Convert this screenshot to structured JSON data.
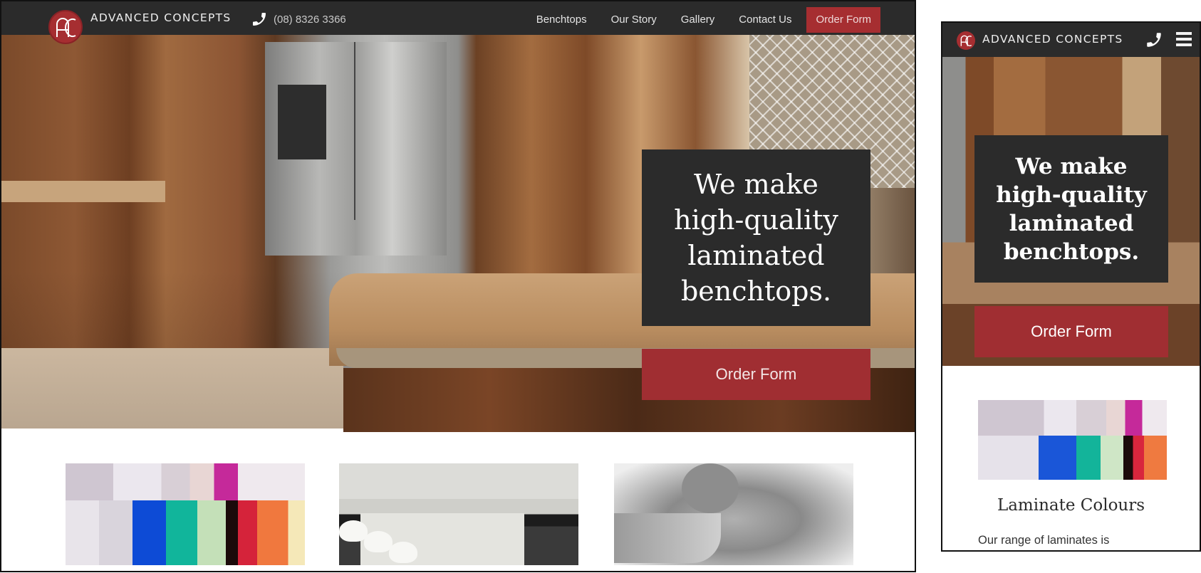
{
  "colors": {
    "nav_bg": "#2b2b2b",
    "accent": "#a02e32",
    "text_light": "#e4e4e4"
  },
  "brand": {
    "name": "ADVANCED CONCEPTS",
    "logo_icon": "ac-monogram-logo"
  },
  "header": {
    "phone_icon": "phone-icon",
    "phone": "(08) 8326 3366",
    "nav": [
      {
        "label": "Benchtops"
      },
      {
        "label": "Our Story"
      },
      {
        "label": "Gallery"
      },
      {
        "label": "Contact Us"
      }
    ],
    "cta": "Order Form"
  },
  "hero": {
    "headline": "We make high-quality laminated benchtops.",
    "button": "Order Form"
  },
  "cards": [
    {
      "image": "laminate-colour-samples"
    },
    {
      "image": "kitchen-island"
    },
    {
      "image": "benchtop-edge-profile"
    }
  ],
  "mobile": {
    "brand": "ADVANCED CONCEPTS",
    "menu_icon": "hamburger-menu-icon",
    "hero_headline": "We make high-quality laminated benchtops.",
    "hero_button": "Order Form",
    "card_title": "Laminate Colours",
    "card_text": "Our range of laminates is"
  }
}
